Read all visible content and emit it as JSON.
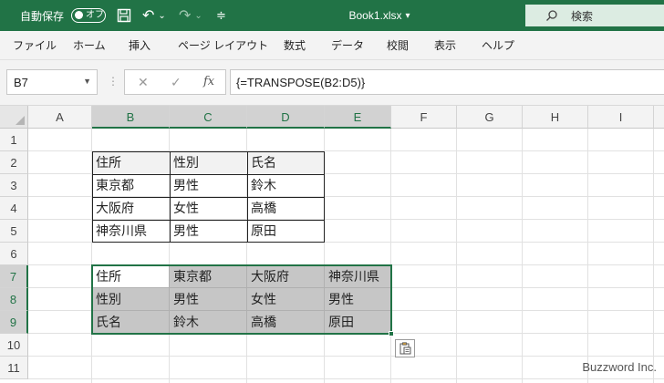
{
  "titlebar": {
    "autosave_label": "自動保存",
    "autosave_toggle": "オフ",
    "file_name": "Book1.xlsx",
    "file_chevron": "▾",
    "search_placeholder": "検索"
  },
  "quick_access": {
    "save_icon": "floppy-disk-icon",
    "undo_icon": "undo-icon",
    "redo_icon": "redo-icon",
    "customize_icon": "customize-icon",
    "undo_glyph": "↶",
    "undo_dropdown": "⌄",
    "redo_glyph": "↷",
    "redo_dropdown": "⌄",
    "customize_glyph": "≑"
  },
  "menu": [
    "ファイル",
    "ホーム",
    "挿入",
    "ページ レイアウト",
    "数式",
    "データ",
    "校閲",
    "表示",
    "ヘルプ"
  ],
  "formula_bar": {
    "name_box": "B7",
    "formula": "{=TRANSPOSE(B2:D5)}",
    "cancel_glyph": "✕",
    "enter_glyph": "✓",
    "fx_glyph": "fx"
  },
  "grid": {
    "columns": [
      "A",
      "B",
      "C",
      "D",
      "E",
      "F",
      "G",
      "H",
      "I"
    ],
    "rows": [
      "1",
      "2",
      "3",
      "4",
      "5",
      "6",
      "7",
      "8",
      "9",
      "10",
      "11"
    ],
    "source_table": [
      [
        "住所",
        "性別",
        "氏名"
      ],
      [
        "東京都",
        "男性",
        "鈴木"
      ],
      [
        "大阪府",
        "女性",
        "高橋"
      ],
      [
        "神奈川県",
        "男性",
        "原田"
      ]
    ],
    "transposed_table": [
      [
        "住所",
        "東京都",
        "大阪府",
        "神奈川県"
      ],
      [
        "性別",
        "男性",
        "女性",
        "男性"
      ],
      [
        "氏名",
        "鈴木",
        "高橋",
        "原田"
      ]
    ]
  },
  "watermark": "Buzzword Inc.",
  "colors": {
    "excel_green": "#217346",
    "selection_fill": "#c6c6c6"
  }
}
